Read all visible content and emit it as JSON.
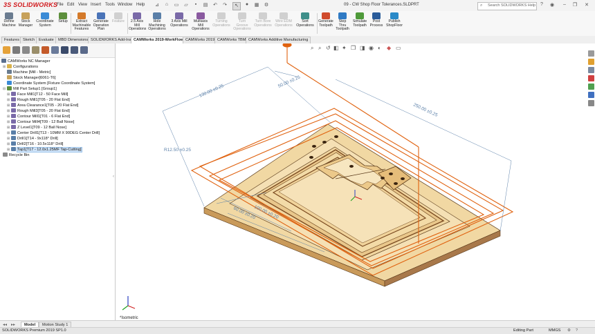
{
  "app": {
    "logo": "3S SOLIDWORKS",
    "menus": [
      "File",
      "Edit",
      "View",
      "Insert",
      "Tools",
      "Window",
      "Help"
    ],
    "document_title": "09 - CW Shop Floor Tolerances.SLDPRT",
    "search_placeholder": "Search SOLIDWORKS Help"
  },
  "command_manager": {
    "buttons": [
      {
        "label": "Define Machine",
        "enabled": true
      },
      {
        "label": "Stock Manager",
        "enabled": true
      },
      {
        "label": "Coordinate System",
        "enabled": true
      },
      {
        "label": "Setup",
        "enabled": true
      },
      {
        "label": "Extract Machinable Features",
        "enabled": true
      },
      {
        "label": "Generate Operation Plan",
        "enabled": true
      },
      {
        "label": "Feature",
        "enabled": false
      },
      {
        "label": "2.5 Axis Mill Operations",
        "enabled": true
      },
      {
        "label": "Hole Machining Operations",
        "enabled": true
      },
      {
        "label": "3 Axis Mill Operations",
        "enabled": true
      },
      {
        "label": "Multiaxis Mill Operations",
        "enabled": true
      },
      {
        "label": "Turning Operations",
        "enabled": false
      },
      {
        "label": "Turn Groove Operations",
        "enabled": false
      },
      {
        "label": "Turn Bore Operations",
        "enabled": false
      },
      {
        "label": "Wire EDM Operations",
        "enabled": false
      },
      {
        "label": "Sort Operations",
        "enabled": true
      },
      {
        "label": "Generate Toolpath",
        "enabled": true
      },
      {
        "label": "Step Thru Toolpath",
        "enabled": true
      },
      {
        "label": "Simulate Toolpath",
        "enabled": true
      },
      {
        "label": "Post Process",
        "enabled": true
      },
      {
        "label": "Publish ShopFloor",
        "enabled": true
      }
    ]
  },
  "tabs": [
    {
      "label": "Features",
      "active": false
    },
    {
      "label": "Sketch",
      "active": false
    },
    {
      "label": "Evaluate",
      "active": false
    },
    {
      "label": "MBD Dimensions",
      "active": false
    },
    {
      "label": "SOLIDWORKS Add-Ins",
      "active": false
    },
    {
      "label": "CAMWorks 2019-WorkFlow",
      "active": true
    },
    {
      "label": "CAMWorks 2019",
      "active": false
    },
    {
      "label": "CAMWorks TBM",
      "active": false
    },
    {
      "label": "CAMWorks Additive Manufacturing",
      "active": false
    }
  ],
  "tree": {
    "root": "CAMWorks NC Manager",
    "items": [
      {
        "label": "Configurations",
        "level": 1,
        "expandable": true,
        "icon": "folder-icon"
      },
      {
        "label": "Machine [Mill - Metric]",
        "level": 1,
        "expandable": false,
        "icon": "machine-icon"
      },
      {
        "label": "Stock Manager[6061-T6]",
        "level": 1,
        "expandable": false,
        "icon": "stock-icon"
      },
      {
        "label": "Coordinate System [Fixture Coordinate System]",
        "level": 1,
        "expandable": false,
        "icon": "coordinate-icon"
      },
      {
        "label": "Mill Part Setup1 [Group1]",
        "level": 1,
        "expandable": true,
        "icon": "setup-icon"
      },
      {
        "label": "Face Mill1[T12 - 50 Face Mill]",
        "level": 2,
        "expandable": true,
        "icon": "operation-icon"
      },
      {
        "label": "Rough Mill1[T05 - 20 Flat End]",
        "level": 2,
        "expandable": true,
        "icon": "operation-icon"
      },
      {
        "label": "Area Clearance1[T05 - 20 Flat End]",
        "level": 2,
        "expandable": true,
        "icon": "operation-icon"
      },
      {
        "label": "Rough Mill3[T05 - 20 Flat End]",
        "level": 2,
        "expandable": true,
        "icon": "operation-icon"
      },
      {
        "label": "Contour Mill1[T01 - 6 Flat End]",
        "level": 2,
        "expandable": true,
        "icon": "operation-icon"
      },
      {
        "label": "Contour Mill4[T09 - 12 Ball Nose]",
        "level": 2,
        "expandable": true,
        "icon": "operation-icon"
      },
      {
        "label": "Z Level1[T09 - 12 Ball Nose]",
        "level": 2,
        "expandable": true,
        "icon": "operation-icon"
      },
      {
        "label": "Center Drill1[T13 - 10MM X 90DEG Center Drill]",
        "level": 2,
        "expandable": true,
        "icon": "drill-icon"
      },
      {
        "label": "Drill1[T14 - 9x118° Drill]",
        "level": 2,
        "expandable": true,
        "icon": "drill-icon"
      },
      {
        "label": "Drill2[T16 - 10.5x118° Drill]",
        "level": 2,
        "expandable": true,
        "icon": "drill-icon"
      },
      {
        "label": "Tap1[T17 - 12.0x1.25MF Tap-Cutting]",
        "level": 2,
        "expandable": true,
        "icon": "tap-icon",
        "selected": true
      },
      {
        "label": "Recycle Bin",
        "level": 1,
        "expandable": false,
        "icon": "recycle-bin-icon"
      }
    ]
  },
  "graphics": {
    "view_label": "*Isometric",
    "dimensions": [
      "130.00 ±0.25",
      "50.00 ±0.25",
      "250.00 ±0.25",
      "R12.50 ±0.25",
      "60.00 ±0.20",
      "100.00 ±0.20"
    ],
    "colors": {
      "part": "#f3d9a6",
      "edges": "#5a3a1a",
      "annotation": "#e0620f",
      "dimension": "#5a7fa8"
    }
  },
  "bottom_tabs": [
    {
      "label": "Model",
      "active": true
    },
    {
      "label": "Motion Study 1",
      "active": false
    }
  ],
  "status": {
    "version": "SOLIDWORKS Premium 2019 SP1.0",
    "mode": "Editing Part",
    "units": "MMGS"
  }
}
